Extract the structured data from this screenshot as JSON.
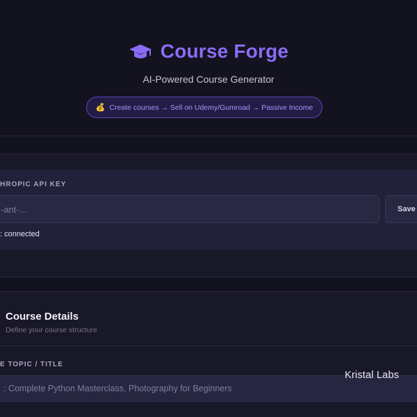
{
  "header": {
    "brand_icon": "graduation-cap-icon",
    "title": "Course Forge",
    "subtitle": "AI-Powered Course Generator",
    "tagline": {
      "icon": "money-bag-icon",
      "icon_glyph": "💰",
      "text": "Create courses → Sell on Udemy/Gumroad → Passive Income"
    }
  },
  "api_key": {
    "label": "HROPIC API KEY",
    "placeholder": "-ant-...",
    "save_label": "Save",
    "status": ": connected"
  },
  "course_details": {
    "title": "Course Details",
    "description": "Define your course structure",
    "topic_label": "E TOPIC / TITLE",
    "topic_placeholder": ": Complete Python Masterclass, Photography for Beginners"
  },
  "watermark": "Kristal Labs",
  "colors": {
    "background": "#13121f",
    "accent": "#8b6cf6",
    "card": "#191828",
    "input": "#292843"
  }
}
